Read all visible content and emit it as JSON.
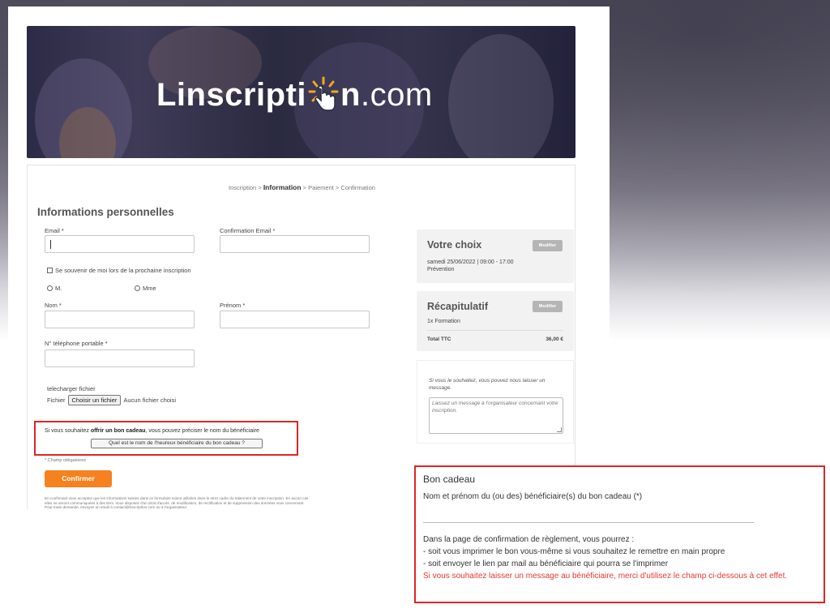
{
  "banner": {
    "logo_part1": "Linscripti",
    "logo_part2": "n",
    "logo_part3": ".com"
  },
  "breadcrumb": {
    "step1": "Inscription",
    "sep": ">",
    "step2": "Information",
    "step3": "Paiement",
    "step4": "Confirmation"
  },
  "form": {
    "title": "Informations personnelles",
    "email_label": "Email *",
    "confirm_email_label": "Confirmation Email *",
    "remember_label": "Se souvenir de moi lors de la prochaine inscription",
    "civility_m": "M.",
    "civility_mme": "Mme",
    "nom_label": "Nom *",
    "prenom_label": "Prénom *",
    "phone_label": "N° téléphone portable *",
    "file_section_label": "telecharger fichier",
    "file_label": "Fichier",
    "file_button": "Choisir un fichier",
    "file_status": "Aucun fichier choisi",
    "gift_text_before": "Si vous souhaitez ",
    "gift_text_bold": "offrir un bon cadeau",
    "gift_text_after": ", vous pouvez préciser le nom du bénéficiaire",
    "gift_button": "Quel est le nom de l'heureux bénéficiaire du bon cadeau ?",
    "required_note": "* Champ obligatoires",
    "confirm_button": "Confirmer",
    "legal_line1": "En confirmant vous acceptez que les informations saisies dans ce formulaire soient utilisées dans le strict cadre du traitement de votre inscription. En aucun cas",
    "legal_line2": "elles ne seront communiquées à des tiers. Vous disposez d'un droit d'accès, de modification, de rectification et de suppression des données vous concernant.",
    "legal_line3": "Pour toute demande, envoyez un email à contact@linscription.com ou à l'organisateur."
  },
  "choice": {
    "title": "Votre choix",
    "modify": "Modifier",
    "date": "samedi 25/06/2022 | 09:00 - 17:00",
    "name": "Prévention"
  },
  "summary": {
    "title": "Récapitulatif",
    "modify": "Modifier",
    "item": "1x Formation",
    "total_label": "Total TTC",
    "total_value": "36,00 €"
  },
  "message": {
    "hint": "Si vous le souhaitez, vous pouvez nous laisser un message.",
    "placeholder": "Laissez un message à l'organisateur concernant votre inscription."
  },
  "popover": {
    "title": "Bon cadeau",
    "label": "Nom et prénom du (ou des) bénéficiaire(s) du bon cadeau (*)",
    "line1": "Dans la page de confirmation de règlement, vous pourrez :",
    "line2": "- soit vous imprimer le bon vous-même si vous souhaitez le remettre en main propre",
    "line3": "- soit envoyer le lien par mail au bénéficiaire qui pourra se l'imprimer",
    "red_text": "Si vous souhaitez laisser un message au bénéficiaire, merci d'utilisez le champ ci-dessous à cet effet."
  },
  "colors": {
    "accent": "#f5821f",
    "highlight": "#e02424",
    "red_text": "#e53935"
  }
}
